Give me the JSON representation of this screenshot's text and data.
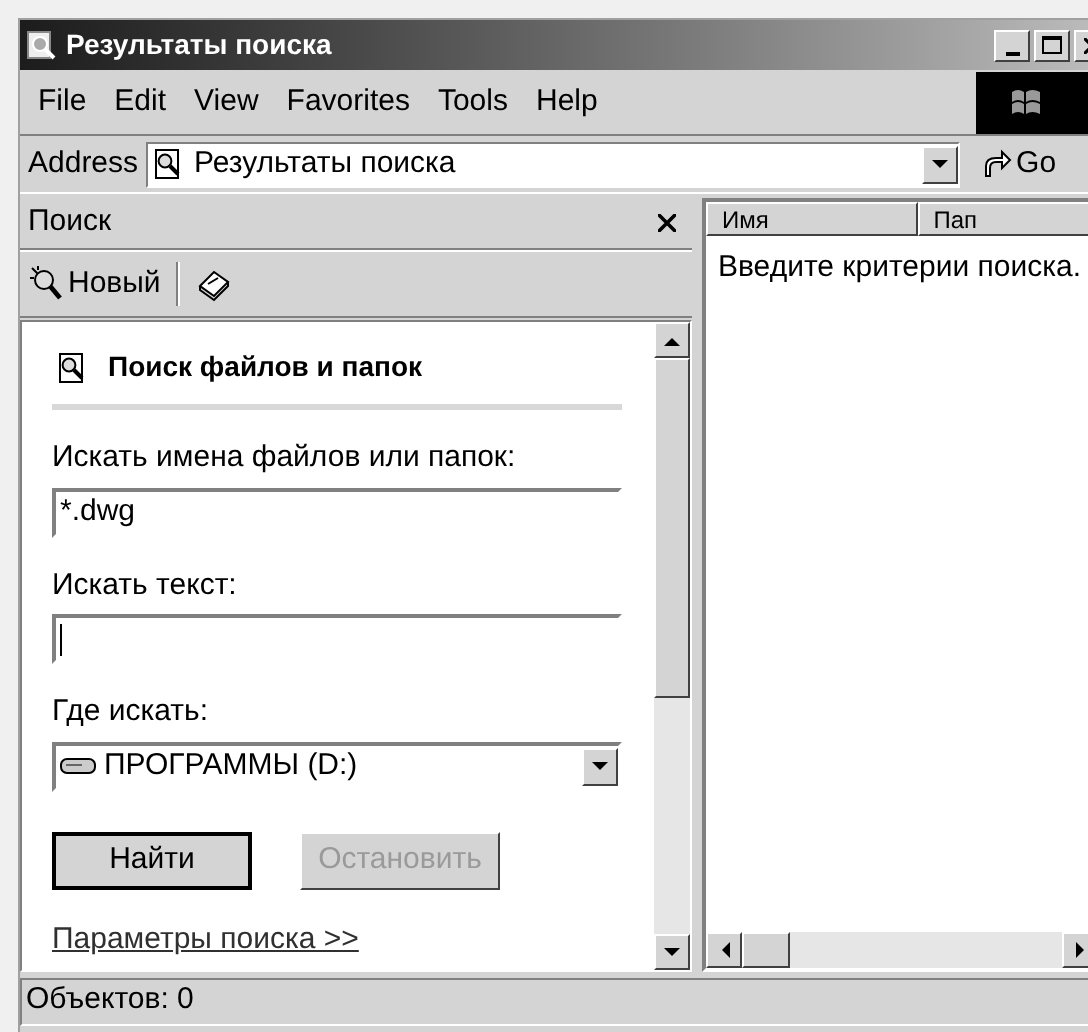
{
  "window": {
    "title": "Результаты поиска"
  },
  "menu": [
    {
      "label": "File"
    },
    {
      "label": "Edit"
    },
    {
      "label": "View"
    },
    {
      "label": "Favorites"
    },
    {
      "label": "Tools"
    },
    {
      "label": "Help"
    }
  ],
  "address": {
    "label": "Address",
    "value": "Результаты поиска",
    "go": "Go"
  },
  "search_pane": {
    "title": "Поиск",
    "new_button": "Новый",
    "heading": "Поиск файлов и папок",
    "fields": [
      {
        "kind": "text",
        "label": "Искать имена файлов или папок:",
        "value": "*.dwg",
        "focused": false
      },
      {
        "kind": "text",
        "label": "Искать текст:",
        "focused": true
      },
      {
        "kind": "dropdown",
        "label": "Где искать:",
        "value": "ПРОГРАММЫ (D:)",
        "focused": false
      }
    ],
    "buttons": [
      {
        "label": "Найти",
        "disabled": false,
        "default": true
      },
      {
        "label": "Остановить",
        "disabled": true,
        "default": false
      }
    ],
    "link": "Параметры поиска >>"
  },
  "results": {
    "columns": [
      "Имя",
      "Пап"
    ],
    "message": "Введите критерии поиска."
  },
  "status_bar": {
    "text": "Объектов: 0"
  }
}
